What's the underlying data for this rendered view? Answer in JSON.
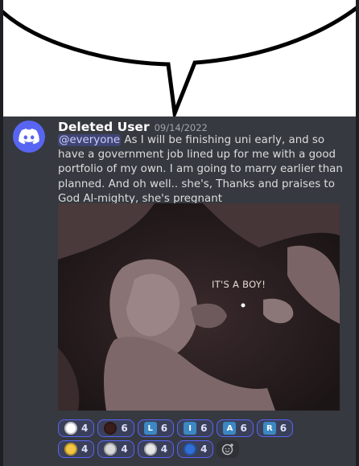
{
  "message": {
    "username": "Deleted User",
    "timestamp": "09/14/2022",
    "mention": "@everyone",
    "text": " As I will be finishing uni early, and so have a government job lined up for me with a good portfolio of my own. I am going to marry earlier than planned. And oh well.. she's, Thanks and praises to God Al-mighty, she's pregnant",
    "attachment_caption": "IT'S A BOY!"
  },
  "colors": {
    "background": "#36393f",
    "accent": "#5865f2",
    "reaction_bg": "#3b405a"
  },
  "reactions": [
    {
      "icon": "reddit-snoo-icon",
      "glyph": "",
      "count": "4",
      "color": "#ffffff"
    },
    {
      "icon": "red-eye-emoji-icon",
      "glyph": "",
      "count": "6",
      "color": "#3a1d1d"
    },
    {
      "icon": "letter-l-icon",
      "glyph": "L",
      "count": "6",
      "color": "#3b88c3"
    },
    {
      "icon": "letter-i-icon",
      "glyph": "I",
      "count": "6",
      "color": "#3b88c3"
    },
    {
      "icon": "letter-a-icon",
      "glyph": "A",
      "count": "6",
      "color": "#3b88c3"
    },
    {
      "icon": "letter-r-icon",
      "glyph": "R",
      "count": "6",
      "color": "#3b88c3"
    },
    {
      "icon": "nerd-face-icon",
      "glyph": "",
      "count": "4",
      "color": "#f4c542"
    },
    {
      "icon": "pixel-character-icon",
      "glyph": "",
      "count": "4",
      "color": "#d8d8d8"
    },
    {
      "icon": "trollface-icon",
      "glyph": "",
      "count": "4",
      "color": "#e6e6e6"
    },
    {
      "icon": "blue-cap-icon",
      "glyph": "",
      "count": "4",
      "color": "#2f6fd6"
    }
  ],
  "add_reaction_icon": "add-reaction-icon"
}
